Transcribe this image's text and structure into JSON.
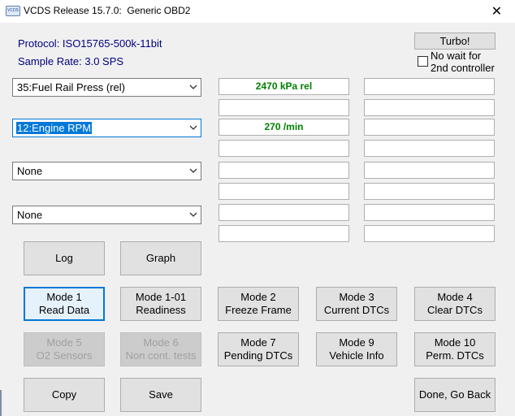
{
  "window": {
    "title": "VCDS Release 15.7.0:  Generic OBD2",
    "icon": "vcds-app-icon",
    "close_glyph": "✕"
  },
  "info": {
    "protocol": "Protocol: ISO15765-500k-11bit",
    "sample_rate": "Sample Rate: 3.0 SPS"
  },
  "turbo": {
    "label": "Turbo!",
    "checkbox_line1": "No wait for",
    "checkbox_line2": "2nd controller",
    "checked": false
  },
  "channels": [
    {
      "selection": "35:Fuel Rail Press (rel)",
      "values": [
        "2470 kPa rel",
        "",
        "",
        ""
      ]
    },
    {
      "selection": "12:Engine RPM",
      "values": [
        "270 /min",
        "",
        "",
        ""
      ]
    },
    {
      "selection": "None",
      "values": [
        "",
        "",
        "",
        ""
      ]
    },
    {
      "selection": "None",
      "values": [
        "",
        "",
        "",
        ""
      ]
    }
  ],
  "buttons": {
    "log": "Log",
    "graph": "Graph",
    "mode1": [
      "Mode 1",
      "Read Data"
    ],
    "mode1_01": [
      "Mode 1-01",
      "Readiness"
    ],
    "mode2": [
      "Mode 2",
      "Freeze Frame"
    ],
    "mode3": [
      "Mode 3",
      "Current DTCs"
    ],
    "mode4": [
      "Mode 4",
      "Clear DTCs"
    ],
    "mode5": [
      "Mode 5",
      "O2 Sensors"
    ],
    "mode6": [
      "Mode 6",
      "Non cont. tests"
    ],
    "mode7": [
      "Mode 7",
      "Pending DTCs"
    ],
    "mode9": [
      "Mode 9",
      "Vehicle Info"
    ],
    "mode10": [
      "Mode 10",
      "Perm. DTCs"
    ],
    "copy": "Copy",
    "save": "Save",
    "done": "Done, Go Back"
  },
  "colors": {
    "info_text": "#000080",
    "value_text": "#008000",
    "focus_blue": "#0078d7",
    "disabled_text": "#a0a0a0"
  }
}
